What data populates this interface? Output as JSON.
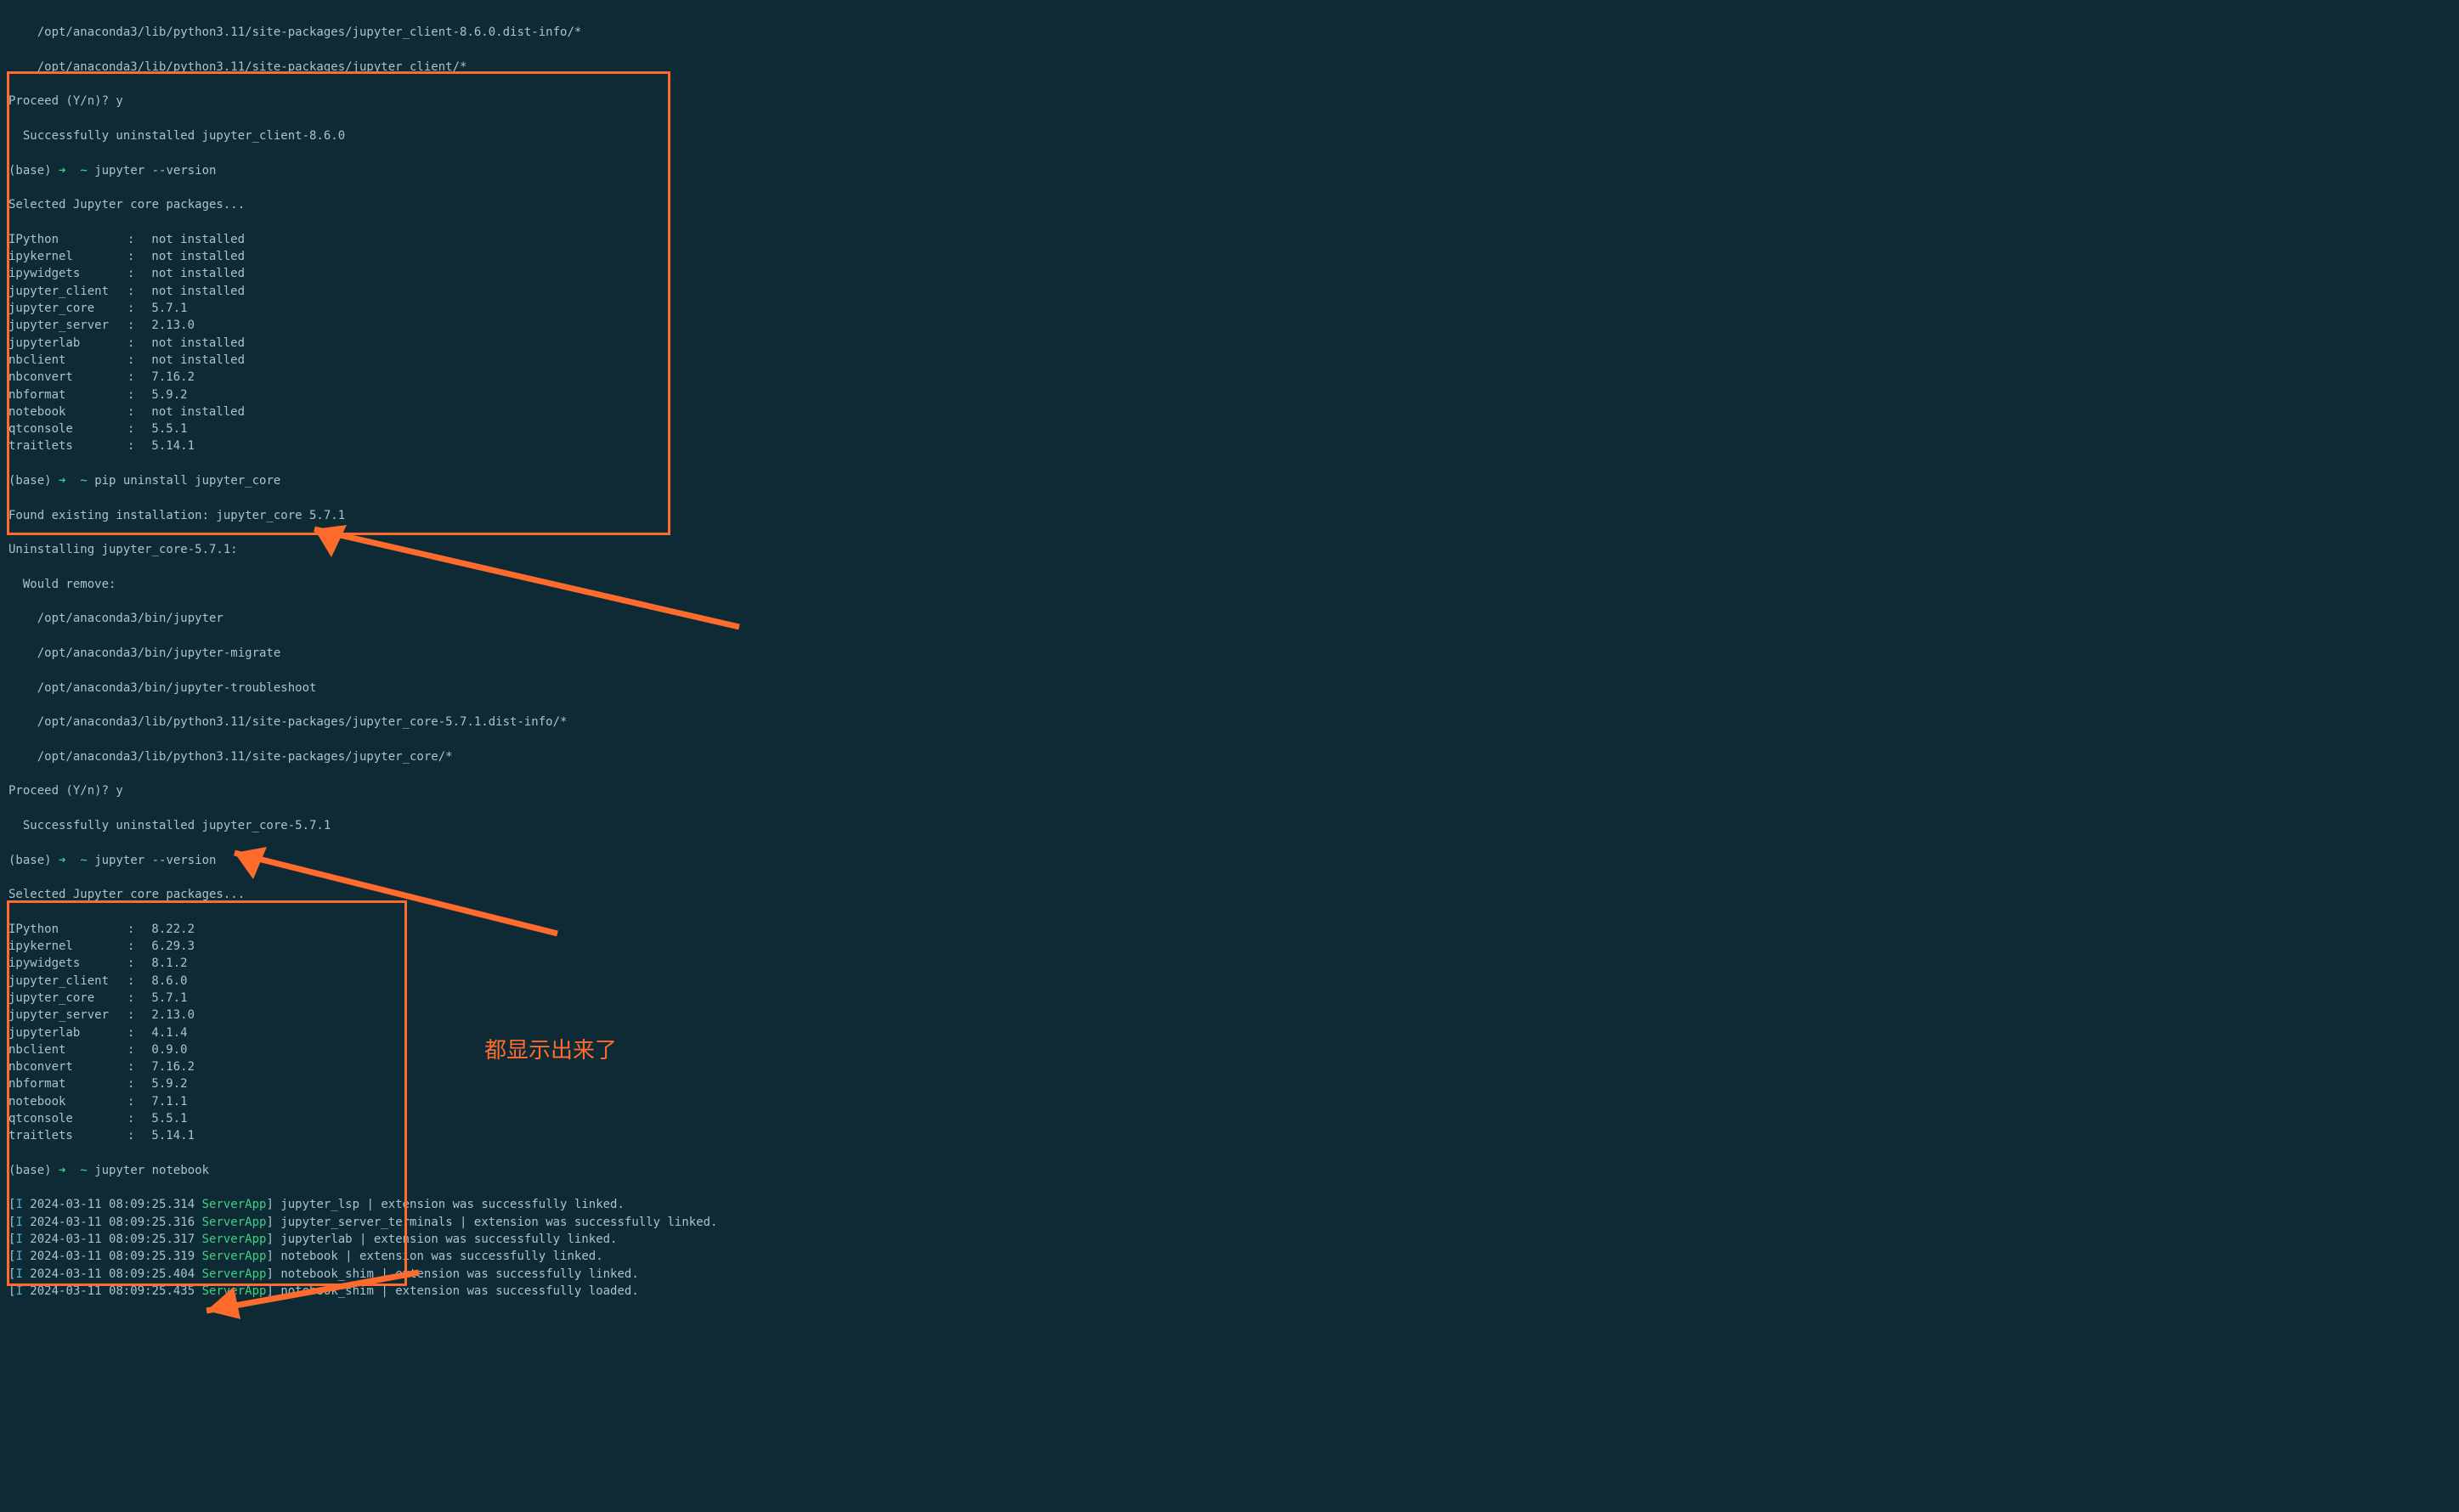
{
  "lines_top": [
    "    /opt/anaconda3/lib/python3.11/site-packages/jupyter_client-8.6.0.dist-info/*",
    "    /opt/anaconda3/lib/python3.11/site-packages/jupyter_client/*"
  ],
  "proceed1": "Proceed (Y/n)? y",
  "success1": "  Successfully uninstalled jupyter_client-8.6.0",
  "prompt_env": "(base)",
  "arrow": "➜",
  "tilde": "~",
  "cmd_version": "jupyter --version",
  "selected_msg": "Selected Jupyter core packages...",
  "packages1": [
    {
      "name": "IPython",
      "val": "not installed"
    },
    {
      "name": "ipykernel",
      "val": "not installed"
    },
    {
      "name": "ipywidgets",
      "val": "not installed"
    },
    {
      "name": "jupyter_client",
      "val": "not installed"
    },
    {
      "name": "jupyter_core",
      "val": "5.7.1"
    },
    {
      "name": "jupyter_server",
      "val": "2.13.0"
    },
    {
      "name": "jupyterlab",
      "val": "not installed"
    },
    {
      "name": "nbclient",
      "val": "not installed"
    },
    {
      "name": "nbconvert",
      "val": "7.16.2"
    },
    {
      "name": "nbformat",
      "val": "5.9.2"
    },
    {
      "name": "notebook",
      "val": "not installed"
    },
    {
      "name": "qtconsole",
      "val": "5.5.1"
    },
    {
      "name": "traitlets",
      "val": "5.14.1"
    }
  ],
  "cmd_uninstall_core": "pip uninstall jupyter_core",
  "found_existing": "Found existing installation: jupyter_core 5.7.1",
  "uninstalling_core": "Uninstalling jupyter_core-5.7.1:",
  "would_remove": "  Would remove:",
  "remove_paths": [
    "    /opt/anaconda3/bin/jupyter",
    "    /opt/anaconda3/bin/jupyter-migrate",
    "    /opt/anaconda3/bin/jupyter-troubleshoot",
    "    /opt/anaconda3/lib/python3.11/site-packages/jupyter_core-5.7.1.dist-info/*",
    "    /opt/anaconda3/lib/python3.11/site-packages/jupyter_core/*"
  ],
  "proceed2": "Proceed (Y/n)? y",
  "success2": "  Successfully uninstalled jupyter_core-5.7.1",
  "packages2": [
    {
      "name": "IPython",
      "val": "8.22.2"
    },
    {
      "name": "ipykernel",
      "val": "6.29.3"
    },
    {
      "name": "ipywidgets",
      "val": "8.1.2"
    },
    {
      "name": "jupyter_client",
      "val": "8.6.0"
    },
    {
      "name": "jupyter_core",
      "val": "5.7.1"
    },
    {
      "name": "jupyter_server",
      "val": "2.13.0"
    },
    {
      "name": "jupyterlab",
      "val": "4.1.4"
    },
    {
      "name": "nbclient",
      "val": "0.9.0"
    },
    {
      "name": "nbconvert",
      "val": "7.16.2"
    },
    {
      "name": "nbformat",
      "val": "5.9.2"
    },
    {
      "name": "notebook",
      "val": "7.1.1"
    },
    {
      "name": "qtconsole",
      "val": "5.5.1"
    },
    {
      "name": "traitlets",
      "val": "5.14.1"
    }
  ],
  "cmd_notebook": "jupyter notebook",
  "logs": [
    {
      "ts": "2024-03-11 08:09:25.314",
      "app": "ServerApp",
      "msg": "jupyter_lsp | extension was successfully linked."
    },
    {
      "ts": "2024-03-11 08:09:25.316",
      "app": "ServerApp",
      "msg": "jupyter_server_terminals | extension was successfully linked."
    },
    {
      "ts": "2024-03-11 08:09:25.317",
      "app": "ServerApp",
      "msg": "jupyterlab | extension was successfully linked."
    },
    {
      "ts": "2024-03-11 08:09:25.319",
      "app": "ServerApp",
      "msg": "notebook | extension was successfully linked."
    },
    {
      "ts": "2024-03-11 08:09:25.404",
      "app": "ServerApp",
      "msg": "notebook_shim | extension was successfully linked."
    },
    {
      "ts": "2024-03-11 08:09:25.435",
      "app": "ServerApp",
      "msg": "notebook_shim | extension was successfully loaded."
    }
  ],
  "annotation_text": "都显示出来了"
}
